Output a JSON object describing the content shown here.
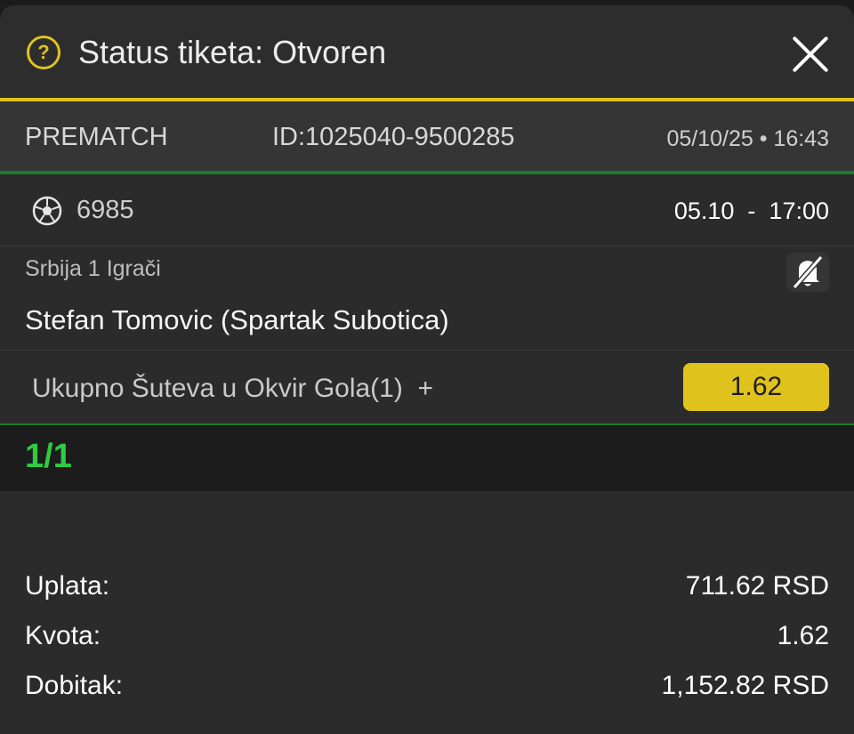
{
  "header": {
    "help_icon": "question-circle-icon",
    "title": "Status tiketa: Otvoren",
    "close_icon": "close-x-icon"
  },
  "info": {
    "type": "PREMATCH",
    "ticket_id": "ID:1025040-9500285",
    "datetime": "05/10/25 • 16:43"
  },
  "event": {
    "sport_icon": "soccer-ball-icon",
    "code": "6985",
    "time": "05.10  -  17:00",
    "league": "Srbija 1 Igrači",
    "notification_icon": "bell-off-icon",
    "player": "Stefan Tomovic (Spartak Subotica)",
    "market": "Ukupno Šuteva u Okvir Gola(1)  +",
    "odd": "1.62"
  },
  "count": "1/1",
  "summary": {
    "stake_label": "Uplata:",
    "stake_value": "711.62 RSD",
    "odds_label": "Kvota:",
    "odds_value": "1.62",
    "win_label": "Dobitak:",
    "win_value": "1,152.82 RSD"
  },
  "colors": {
    "accent_yellow": "#e0c21d",
    "accent_green": "#2ecc40",
    "divider_green": "#1d7a2c",
    "background": "#2b2b2b"
  }
}
